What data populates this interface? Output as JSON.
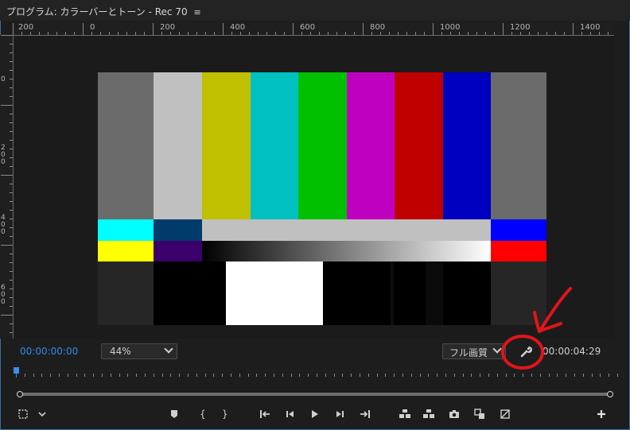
{
  "window": {
    "title": "プログラム: カラーバーとトーン - Rec 70",
    "menu_glyph": "≡"
  },
  "ruler_top": {
    "labels": [
      "200",
      "0",
      "200",
      "400",
      "600",
      "800",
      "1000",
      "1200",
      "1400"
    ]
  },
  "ruler_left": {
    "labels": [
      "0",
      "2\n0\n0",
      "4\n0\n0",
      "6\n0\n0"
    ]
  },
  "viewer": {
    "colors": {
      "top": [
        "#6b6b6b",
        "#c0c0c0",
        "#c0c000",
        "#00c0c0",
        "#00c000",
        "#c000c0",
        "#c00000",
        "#0000c0",
        "#6b6b6b"
      ],
      "mid_left": [
        "#00ffff",
        "#003b6b"
      ],
      "mid_gray": "#c0c0c0",
      "mid_right": "#0000ff",
      "low_left": [
        "#ffff00",
        "#3b006b"
      ],
      "low_right": "#ff0000",
      "bottom": [
        "#262626",
        "#000000",
        "#ffffff",
        "#000000",
        "#262626"
      ]
    }
  },
  "controls": {
    "current_time": "00:00:00:00",
    "zoom": "44%",
    "quality": "フル画質",
    "duration": "00:00:04:29"
  },
  "toolbar": {
    "icons": [
      "select-zoom-icon",
      "chevron-down-icon",
      "add-marker-icon",
      "mark-in-icon",
      "mark-out-icon",
      "go-to-in-icon",
      "step-back-icon",
      "play-icon",
      "step-forward-icon",
      "go-to-out-icon",
      "lift-icon",
      "extract-icon",
      "export-frame-icon",
      "comparison-view-icon",
      "proxy-toggle-icon",
      "add-button-icon"
    ]
  },
  "annotation": {
    "color": "#e0151b"
  }
}
